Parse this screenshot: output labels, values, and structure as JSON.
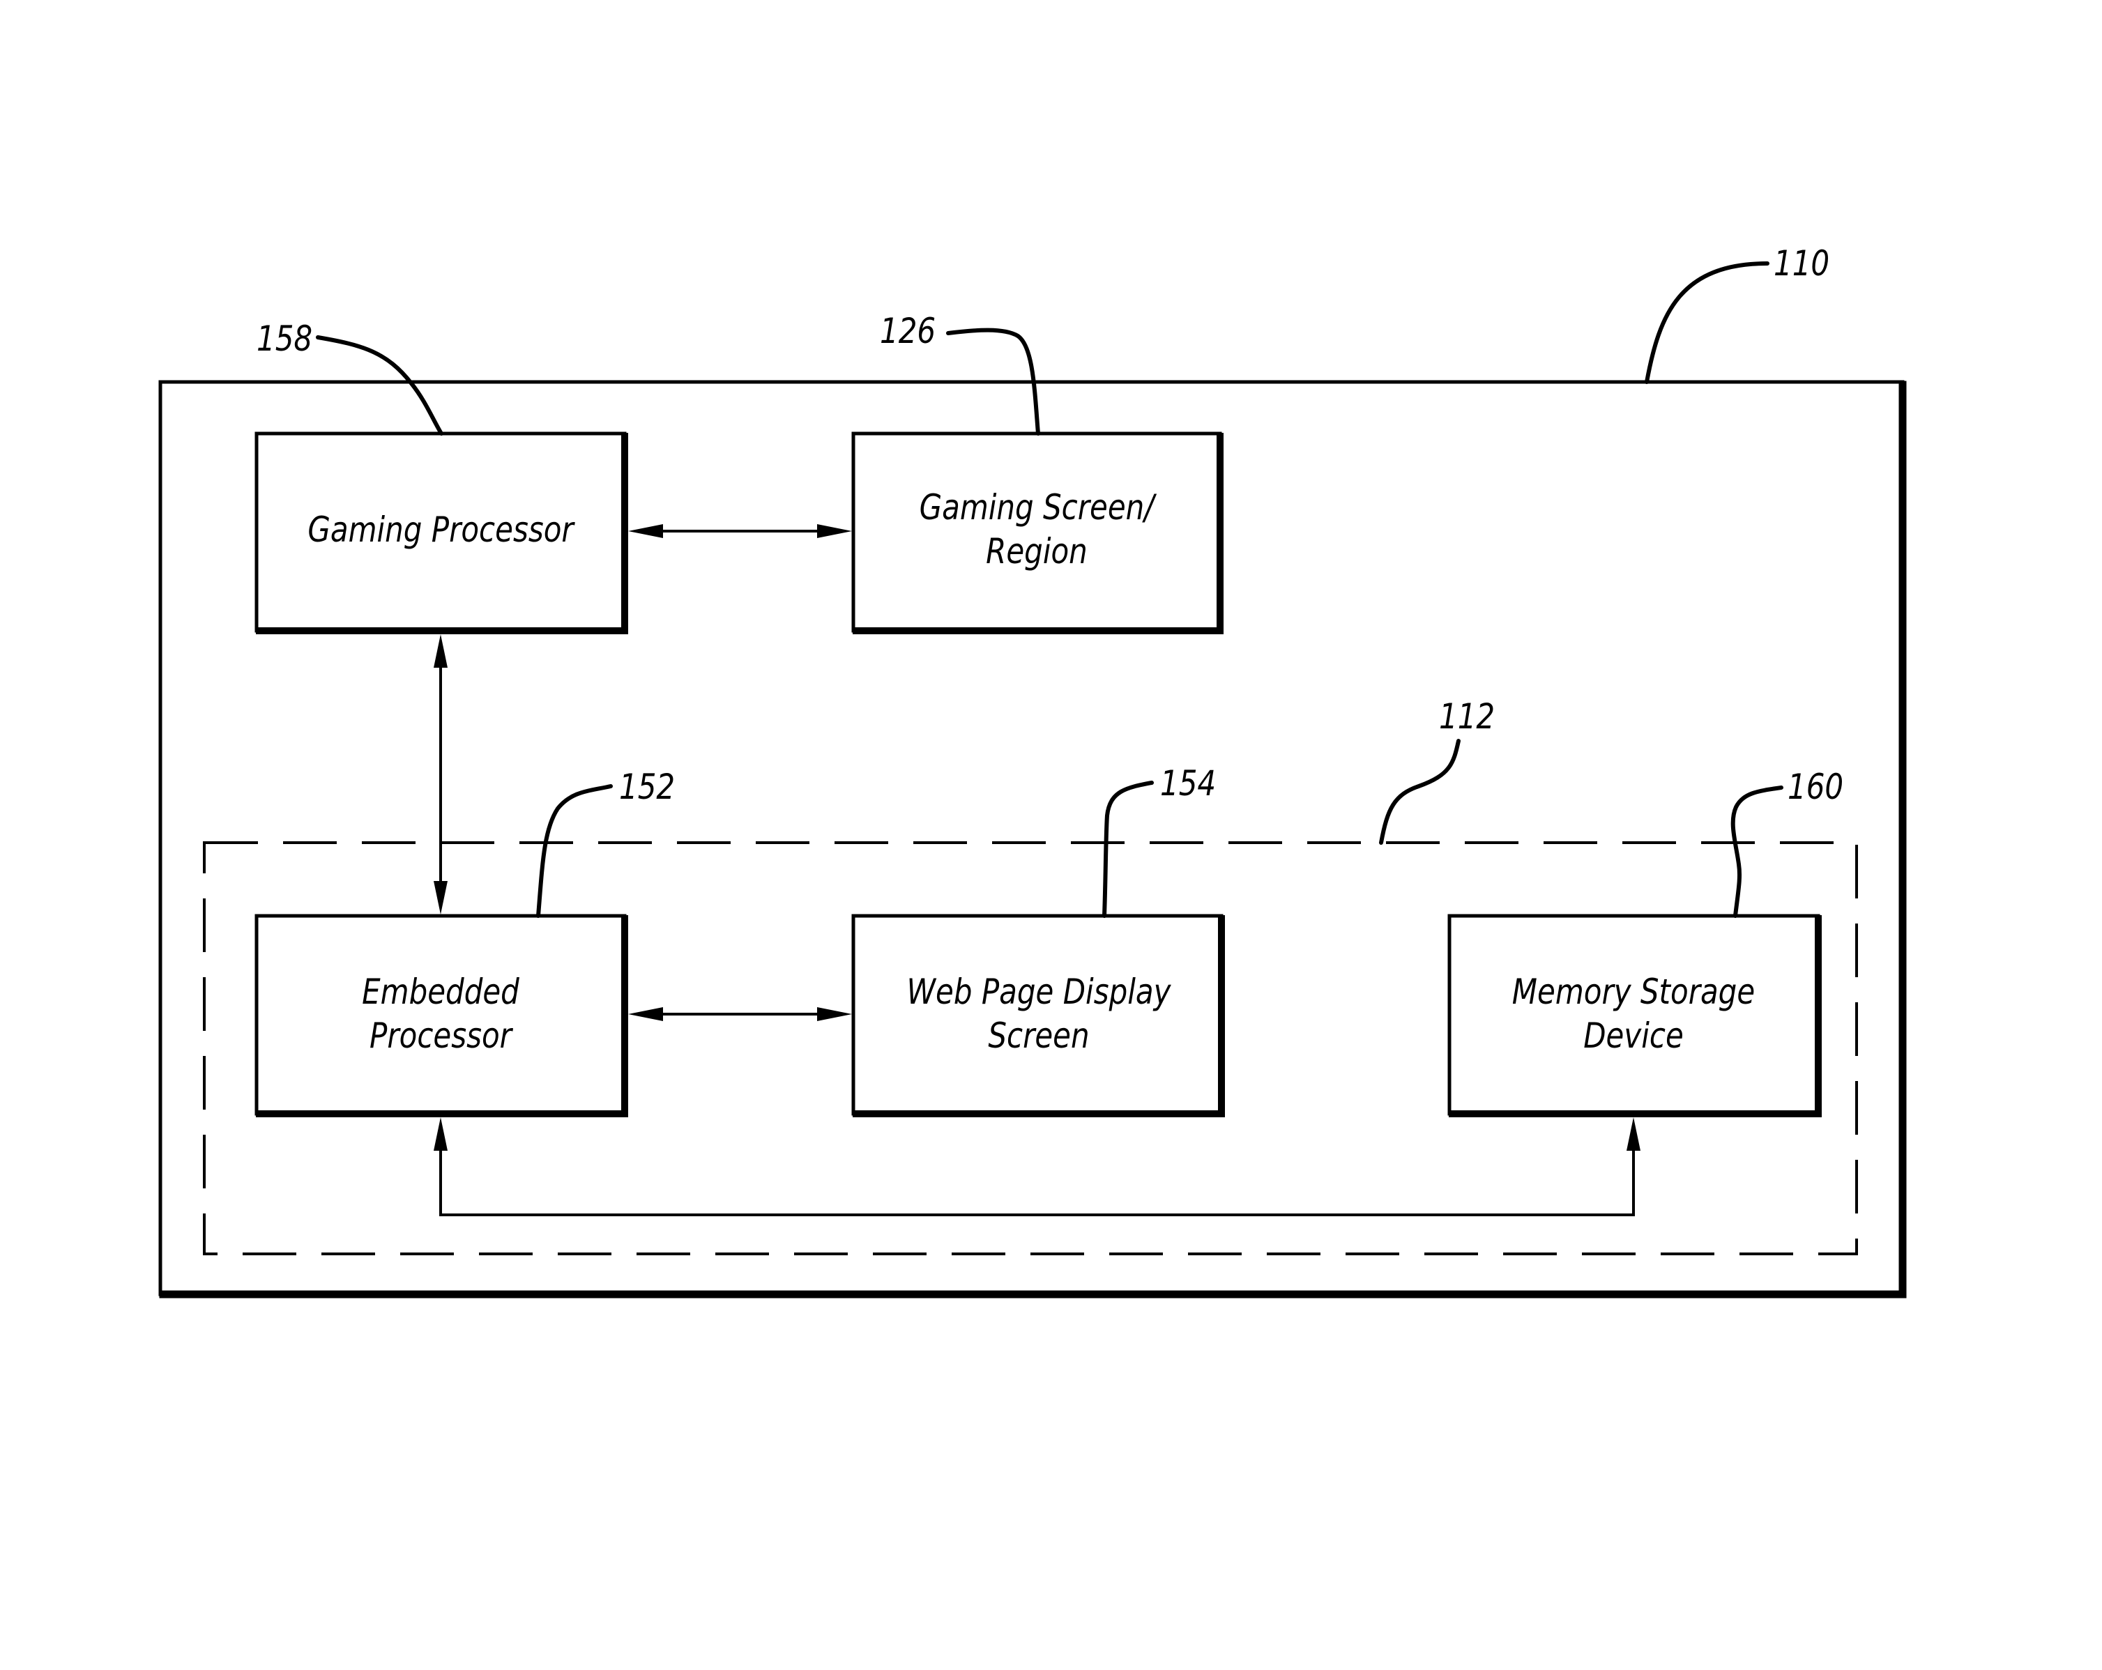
{
  "figure": {
    "type": "block-diagram",
    "colors": {
      "ink": "#000000",
      "background": "#ffffff"
    },
    "system": {
      "ref": "110"
    },
    "subsystem": {
      "ref": "112",
      "style": "dashed"
    },
    "blocks": {
      "gaming_processor": {
        "ref": "158",
        "lines": [
          "Gaming Processor"
        ]
      },
      "gaming_screen": {
        "ref": "126",
        "lines": [
          "Gaming Screen/",
          "Region"
        ]
      },
      "embedded_processor": {
        "ref": "152",
        "lines": [
          "Embedded",
          "Processor"
        ]
      },
      "web_page_display": {
        "ref": "154",
        "lines": [
          "Web Page Display",
          "Screen"
        ]
      },
      "memory_storage": {
        "ref": "160",
        "lines": [
          "Memory Storage",
          "Device"
        ]
      }
    },
    "connections": [
      {
        "from": "gaming_processor",
        "to": "gaming_screen",
        "direction": "bidirectional"
      },
      {
        "from": "gaming_processor",
        "to": "embedded_processor",
        "direction": "bidirectional"
      },
      {
        "from": "embedded_processor",
        "to": "web_page_display",
        "direction": "bidirectional"
      },
      {
        "from": "embedded_processor",
        "to": "memory_storage",
        "direction": "bidirectional"
      }
    ]
  }
}
